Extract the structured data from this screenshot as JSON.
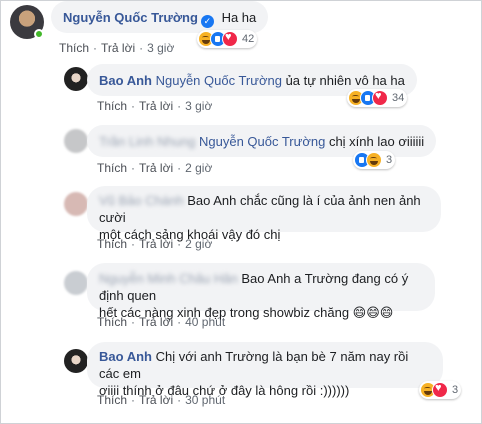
{
  "actions": {
    "like": "Thích",
    "reply": "Trả lời"
  },
  "comments": [
    {
      "author": "Nguyễn Quốc Trường",
      "text": "Ha ha",
      "time": "3 giờ",
      "reactions": [
        "haha",
        "like",
        "love"
      ],
      "reaction_count": "42"
    },
    {
      "author": "Bao Anh",
      "tag": "Nguyễn Quốc Trường",
      "text": "ủa tự nhiên vô ha ha",
      "time": "3 giờ",
      "reactions": [
        "haha",
        "like",
        "love"
      ],
      "reaction_count": "34"
    },
    {
      "author": "Trần Linh Nhung",
      "tag": "Nguyễn Quốc Trường",
      "text": "chị xính lao ơiiiiii",
      "time": "2 giờ",
      "reactions": [
        "like",
        "haha"
      ],
      "reaction_count": "3"
    },
    {
      "author": "Vũ Bảo Chánh",
      "text": "Bao Anh chắc cũng là í của ảnh nen ảnh cười một cách sảng khoái vậy đó chị",
      "line1": "Bao Anh chắc cũng là í của ảnh nen ảnh cười",
      "line2": "một cách sảng khoái vậy đó chị",
      "time": "2 giờ"
    },
    {
      "author": "Nguyễn Minh Châu Hân",
      "line1": "Bao Anh a Trường đang có ý định quen",
      "line2": "hết các nàng xinh đẹp trong showbiz chăng 😄😄😄",
      "time": "40 phút"
    },
    {
      "author": "Bao Anh",
      "line1": "Chị với anh Trường là bạn bè 7 năm nay rồi các em",
      "line2": "ơiiii thính ở đâu chứ ở đây là hông rồi :))))))",
      "time": "30 phút",
      "reactions": [
        "haha",
        "love"
      ],
      "reaction_count": "3"
    }
  ],
  "colors": {
    "link": "#385898",
    "bubble": "#f2f3f5",
    "online": "#42b72a"
  }
}
